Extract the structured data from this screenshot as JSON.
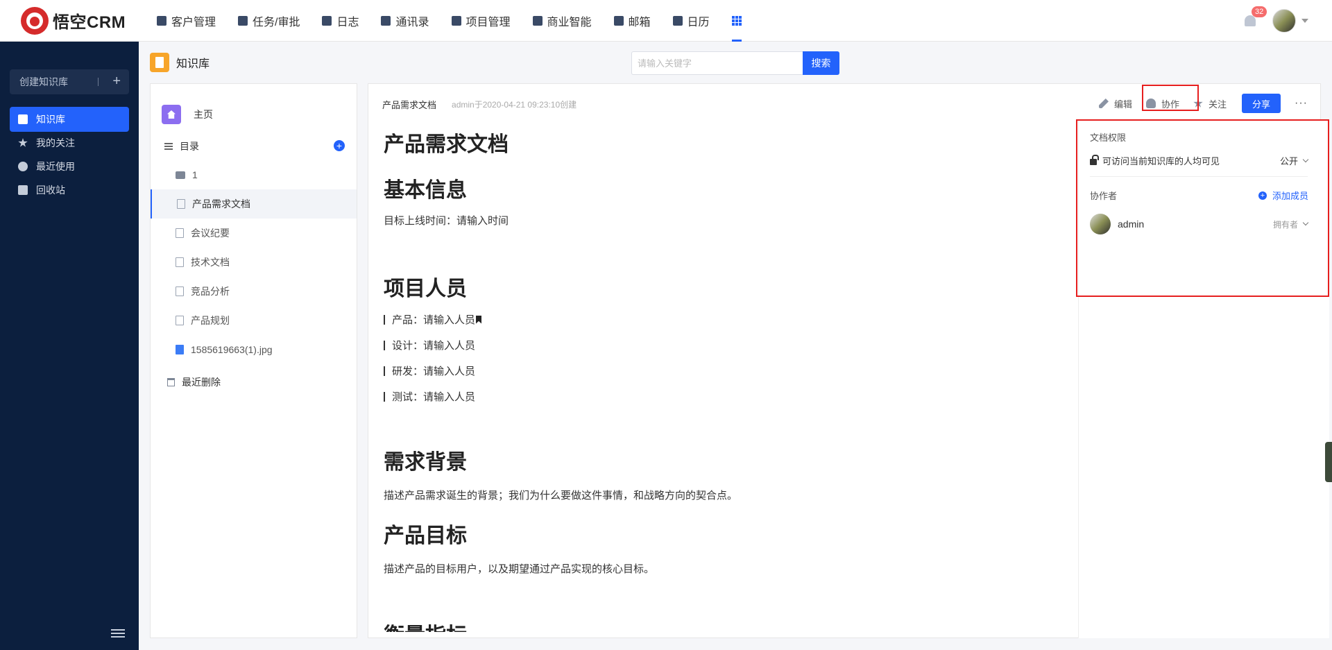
{
  "brand": {
    "name": "悟空CRM"
  },
  "nav": {
    "items": [
      {
        "label": "客户管理",
        "icon": "customer-icon"
      },
      {
        "label": "任务/审批",
        "icon": "briefcase-icon"
      },
      {
        "label": "日志",
        "icon": "log-icon"
      },
      {
        "label": "通讯录",
        "icon": "phone-book-icon"
      },
      {
        "label": "项目管理",
        "icon": "project-icon"
      },
      {
        "label": "商业智能",
        "icon": "bi-icon"
      },
      {
        "label": "邮箱",
        "icon": "mail-icon"
      },
      {
        "label": "日历",
        "icon": "calendar-icon"
      }
    ],
    "notification_count": "32",
    "accent": "#2362fb"
  },
  "sidebar": {
    "create_label": "创建知识库",
    "items": [
      {
        "label": "知识库",
        "icon": "book-icon",
        "active": true
      },
      {
        "label": "我的关注",
        "icon": "star-icon"
      },
      {
        "label": "最近使用",
        "icon": "clock-icon"
      },
      {
        "label": "回收站",
        "icon": "trash-icon"
      }
    ]
  },
  "header": {
    "title": "知识库",
    "search_placeholder": "请输入关键字",
    "search_button": "搜索"
  },
  "tree": {
    "home": "主页",
    "directory": "目录",
    "items": [
      {
        "label": "1",
        "type": "folder"
      },
      {
        "label": "产品需求文档",
        "type": "doc",
        "active": true
      },
      {
        "label": "会议纪要",
        "type": "doc"
      },
      {
        "label": "技术文档",
        "type": "doc"
      },
      {
        "label": "竞品分析",
        "type": "doc"
      },
      {
        "label": "产品规划",
        "type": "doc"
      },
      {
        "label": "1585619663(1).jpg",
        "type": "image"
      }
    ],
    "recently_deleted": "最近删除"
  },
  "doc": {
    "name": "产品需求文档",
    "created": "admin于2020-04-21 09:23:10创建",
    "actions": {
      "edit": "编辑",
      "collaborate": "协作",
      "follow": "关注",
      "share": "分享",
      "more": "···"
    },
    "content": {
      "title": "产品需求文档",
      "h_basic": "基本信息",
      "p_launch": "目标上线时间：请输入时间",
      "h_people": "项目人员",
      "people": [
        "产品：请输入人员",
        "设计：请输入人员",
        "研发：请输入人员",
        "测试：请输入人员"
      ],
      "h_background": "需求背景",
      "p_background": "描述产品需求诞生的背景；我们为什么要做这件事情，和战略方向的契合点。",
      "h_goal": "产品目标",
      "p_goal": "描述产品的目标用户，以及期望通过产品实现的核心目标。",
      "h_metrics": "衡量指标"
    }
  },
  "permissions": {
    "title": "文档权限",
    "visibility_desc": "可访问当前知识库的人均可见",
    "visibility_value": "公开",
    "collaborators_title": "协作者",
    "add_member": "添加成员",
    "members": [
      {
        "name": "admin",
        "role": "拥有者"
      }
    ]
  }
}
